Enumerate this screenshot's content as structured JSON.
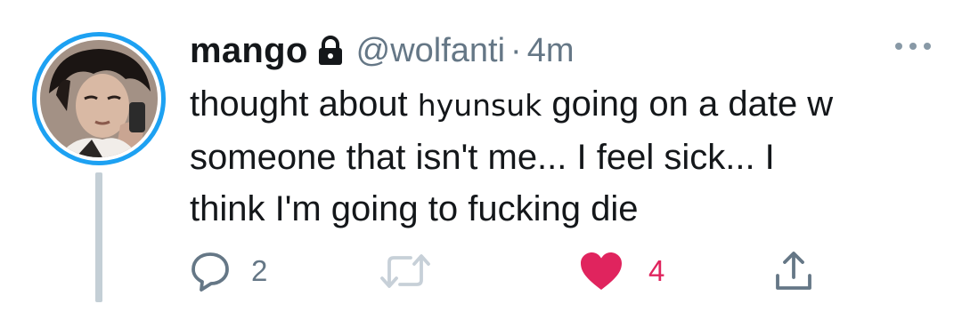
{
  "tweet": {
    "display_name": "mango",
    "handle": "@wolfanti",
    "separator": "·",
    "time": "4m",
    "text_lines": [
      {
        "before": "thought about ",
        "name": "hyunsuk",
        "after": " going on a date w"
      },
      "someone that isn't me... I feel sick... I",
      "think I'm going to fucking die"
    ]
  },
  "actions": {
    "reply_count": "2",
    "like_count": "4"
  },
  "icons": {
    "lock": "lock-icon",
    "more": "more-dots-icon",
    "reply": "reply-bubble-icon",
    "retweet": "retweet-icon",
    "like": "heart-icon",
    "share": "share-icon"
  },
  "colors": {
    "accent_blue": "#1da1f2",
    "like_red": "#e0245e",
    "muted_gray": "#657786",
    "text": "#14171a",
    "thread_line": "#c4cfd6"
  }
}
